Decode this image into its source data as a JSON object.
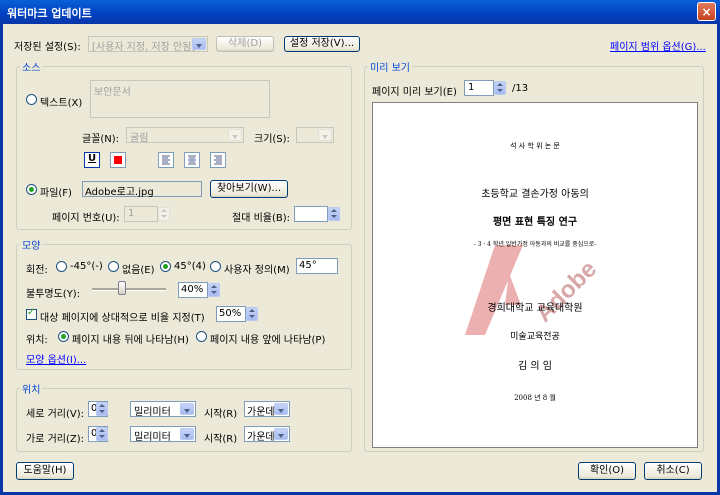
{
  "window": {
    "title": "워터마크 업데이트",
    "close_glyph": "×"
  },
  "top": {
    "saved_settings_label": "저장된 설정(S):",
    "saved_settings_value": "[사용자 지정, 저장 안됨]",
    "delete_label": "삭제(D)",
    "save_settings_label": "설정 저장(V)...",
    "page_range_label": "페이지 범위 옵션(G)..."
  },
  "source": {
    "title": "소스",
    "text_radio_label": "텍스트(X)",
    "text_value": "보안문서",
    "font_label": "글꼴(N):",
    "font_value": "굴림",
    "size_label": "크기(S):",
    "underline_glyph": "U",
    "file_radio_label": "파일(F)",
    "file_value": "Adobe로고.jpg",
    "browse_label": "찾아보기(W)...",
    "page_number_label": "페이지 번호(U):",
    "page_number_value": "1",
    "abs_scale_label": "절대 비율(B):"
  },
  "appearance": {
    "title": "모양",
    "rotation_label": "회전:",
    "rot_options": [
      "-45°(-)",
      "없음(E)",
      "45°(4)",
      "사용자 정의(M)"
    ],
    "rot_custom_value": "45°",
    "opacity_label": "불투명도(Y):",
    "opacity_value": "40%",
    "opacity_level": 0.4,
    "relative_scale_label": "대상 페이지에 상대적으로 비율 지정(T)",
    "relative_scale_value": "50%",
    "location_label": "위치:",
    "behind_label": "페이지 내용 뒤에 나타남(H)",
    "front_label": "페이지 내용 앞에 나타남(P)",
    "options_link": "모양 옵션(I)..."
  },
  "position": {
    "title": "위치",
    "vertical_label": "세로 거리(V):",
    "vertical_value": "0",
    "vertical_unit": "밀리미터",
    "vertical_from_label": "시작(R)",
    "vertical_from_value": "가운데",
    "horizontal_label": "가로 거리(Z):",
    "horizontal_value": "0",
    "horizontal_unit": "밀리미터",
    "horizontal_from_label": "시작(R)",
    "horizontal_from_value": "가운데"
  },
  "preview": {
    "title": "미리 보기",
    "page_label": "페이지 미리 보기(E)",
    "page_value": "1",
    "page_total": "/13",
    "doc_lines": [
      "석 사 학 위 논 문",
      "초등학교 결손가정 아동의",
      "평면 표현 특징 연구",
      "- 3 · 4 학년 일반가정 아동과의 비교를 중심으로-",
      "경희대학교 교육대학원",
      "미술교육전공",
      "김 의 임",
      "2008 년 8 월"
    ],
    "watermark_text": "Adobe"
  },
  "footer": {
    "help_label": "도움말(H)",
    "ok_label": "확인(O)",
    "cancel_label": "취소(C)"
  },
  "colors": {
    "accent": "#0046d5",
    "watermark": "#e8a0a0",
    "color_swatch": "#ff0000"
  }
}
